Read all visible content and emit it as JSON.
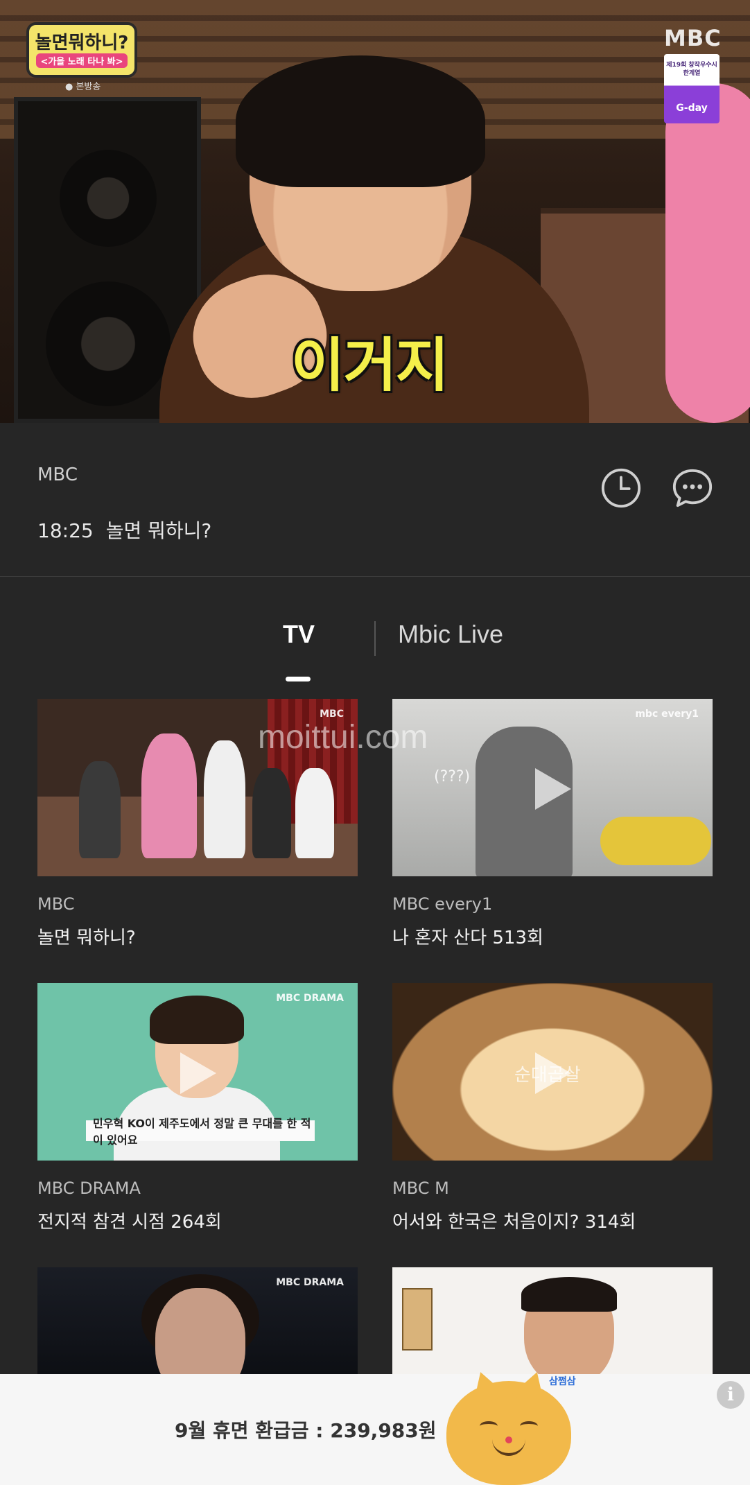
{
  "player": {
    "show_logo_title": "놀면뭐하니?",
    "show_logo_subtitle": "<가을 노래 타나 봐>",
    "broadcast_badge": "● 본방송",
    "channel_bug": "MBC",
    "promo_line1": "제19회 창작우수시한계열",
    "promo_line2": "G-day",
    "caption": "이거지"
  },
  "info": {
    "channel": "MBC",
    "time": "18:25",
    "program": "놀면 뭐하니?",
    "schedule_icon": "clock-icon",
    "chat_icon": "chat-bubble-icon"
  },
  "tabs": [
    {
      "label": "TV",
      "active": true
    },
    {
      "label": "Mbic Live",
      "active": false
    }
  ],
  "watermark": "moittui.com",
  "cards": [
    {
      "channel": "MBC",
      "title": "놀면 뭐하니?",
      "bug": "MBC",
      "selected": true
    },
    {
      "channel": "MBC every1",
      "title": "나 혼자 산다 513회",
      "bug": "mbc every1",
      "tag": "(???)"
    },
    {
      "channel": "MBC DRAMA",
      "title": "전지적 참견 시점 264회",
      "bug": "MBC DRAMA",
      "subtitle": "민우혁  KO이 제주도에서 정말 큰 무대를 한 적이 있어요"
    },
    {
      "channel": "MBC M",
      "title": "어서와 한국은 처음이지? 314회",
      "tag": "순대곱살"
    },
    {
      "channel": "",
      "title": "",
      "bug": "MBC DRAMA"
    },
    {
      "channel": "",
      "title": ""
    }
  ],
  "ad": {
    "text": "9월 휴면 환급금 : 239,983원",
    "brand": "삼쩜삼",
    "info_icon": "info-icon"
  },
  "colors": {
    "background": "#262626",
    "active_tab": "#ffffff",
    "caption_yellow": "#f4ef4a",
    "ad_background": "#f6f6f6"
  }
}
